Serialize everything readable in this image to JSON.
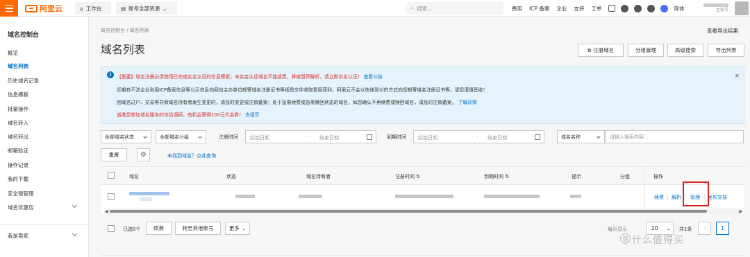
{
  "topbar": {
    "logo_text": "阿里云",
    "workbench": "工作台",
    "resources": "账号全部资源",
    "search_placeholder": "搜索...",
    "links": [
      "费用",
      "ICP 备案",
      "企业",
      "支持",
      "工单"
    ],
    "lang": "简体",
    "account_sub": "主账号"
  },
  "sidebar": {
    "title": "域名控制台",
    "items": [
      "概览",
      "域名列表",
      "历史域名记录",
      "信息模板",
      "批量操作",
      "域名转入",
      "域名转出",
      "邮箱验证",
      "操作记录",
      "我的下载",
      "安全锁管理",
      "域名优惠包"
    ],
    "active_index": 1,
    "bottom_item": "我是卖家"
  },
  "header": {
    "breadcrumb": "域名控制台 / 域名列表",
    "export_result": "查看导出结果",
    "title": "域名列表",
    "buttons": [
      "注册域名",
      "分组管理",
      "高级搜索",
      "导出列表"
    ]
  },
  "notice": {
    "l1_red": "【重要】域名注册必须使用已完成实名认证的信息模板；未实名认证域名不能续费，将被暂停解析，请立即实名认证！",
    "l1_link": "查看公告",
    "l2": "近期有不法企业利用ICP备案信息等公示信息向网站主办单位邮寄域名注册证书等纸质文件收取费用获利，阿里云不会以快递到付的方式向您邮寄域名注册证书等，请您谨慎签收！",
    "l3": "因域名过户、交易等导致域名持有者发生变更的，请及时变更或注销备案；处于急需续费或急需赎回状态的域名，如您确认不再续费或赎回域名，请及时注销备案。",
    "l3_link": "了解详情",
    "l4_red": "诚邀您参加域名服务的体验调研，有机会获得100元代金券！",
    "l4_link": "去填写"
  },
  "filters": {
    "status": "全部域名状态",
    "group": "全部域名分组",
    "reg_label": "注册时间",
    "exp_label": "到期时间",
    "start_placeholder": "起始日期",
    "end_placeholder": "结束日期",
    "sep": "-",
    "name_select": "域名名称",
    "keyword_placeholder": "请输入搜索内容...",
    "reset": "重置",
    "not_found": "未找到域名？点此查询"
  },
  "table": {
    "headers": [
      "域名",
      "状态",
      "域名持有者",
      "注册时间 ⇅",
      "到期时间 ⇅",
      "提示",
      "分组",
      "操作"
    ],
    "actions": [
      "续费",
      "解析",
      "管理",
      "发布交易"
    ]
  },
  "footer": {
    "selected": "已选0个",
    "buttons": [
      "续费",
      "转至其他账号",
      "更多"
    ],
    "page_size_label": "每页显示",
    "page_size": "20",
    "total": "共1条",
    "current_page": "1"
  },
  "watermark": "什么值得买",
  "colors": {
    "brand": "#ff6a00",
    "link": "#0070cc",
    "highlight_box": "#e02020"
  }
}
